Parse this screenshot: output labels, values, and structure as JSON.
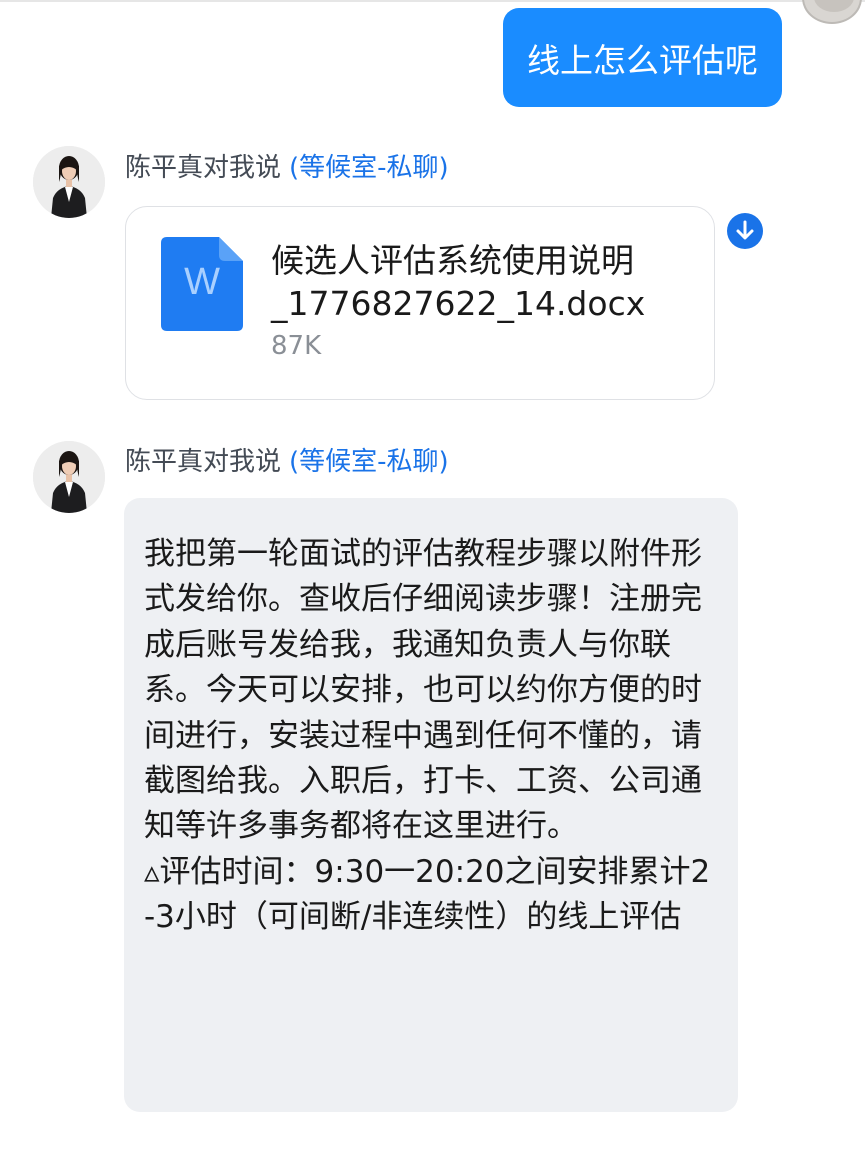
{
  "outgoing_message": "线上怎么评估呢",
  "messages": [
    {
      "sender": "陈平真对我说",
      "chat_tag": "(等候室-私聊)",
      "attachment": {
        "icon": "word-icon",
        "icon_letter": "W",
        "file_name": "候选人评估系统使用说明\n_1776827622_14.docx",
        "file_size": "87K"
      }
    },
    {
      "sender": "陈平真对我说",
      "chat_tag": "(等候室-私聊)",
      "text_paragraph_1": "我把第一轮面试的评估教程步骤以附件形式发给你。查收后仔细阅读步骤！注册完成后账号发给我，我通知负责人与你联系。今天可以安排，也可以约你方便的时间进行，安装过程中遇到任何不懂的，请截图给我。入职后，打卡、工资、公司通知等许多事务都将在这里进行。",
      "text_paragraph_2": "▵评估时间：9:30一20:20之间安排累计2-3小时（可间断/非连续性）的线上评估"
    }
  ],
  "colors": {
    "outgoing_bubble": "#1a8cff",
    "incoming_bubble": "#eef0f3",
    "link_blue": "#1a73e8",
    "word_icon_blue": "#1f7cf2"
  }
}
